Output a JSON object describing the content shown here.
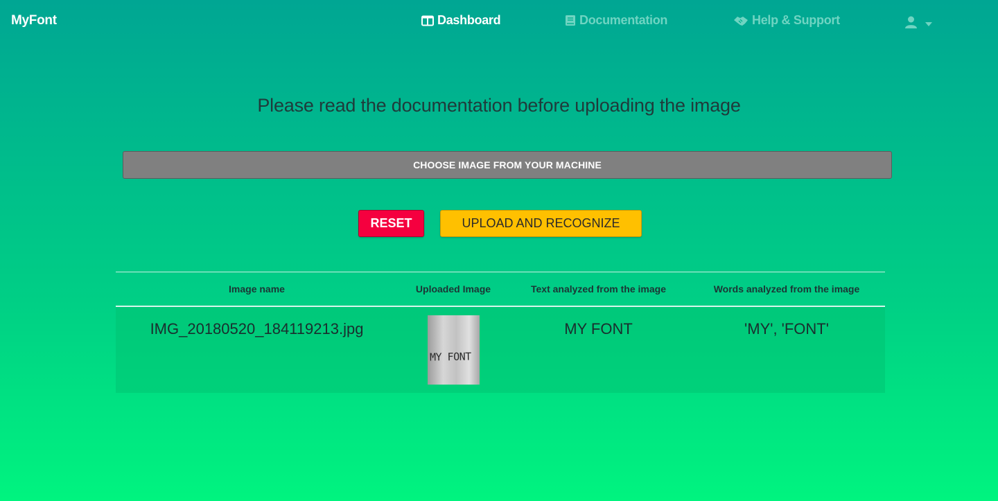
{
  "app": {
    "brand": "MyFont"
  },
  "nav": {
    "dashboard": {
      "label": "Dashboard",
      "icon": "columns-icon",
      "color": "#ffffff"
    },
    "documentation": {
      "label": "Documentation",
      "icon": "book-icon",
      "color": "#6fd4c2"
    },
    "help": {
      "label": "Help & Support",
      "icon": "handshake-icon",
      "color": "#6fd4c2"
    },
    "user": {
      "icon": "user-icon",
      "dropdown_icon": "caret-down-icon"
    }
  },
  "main": {
    "headline": "Please read the documentation before uploading the image",
    "choose_button": "CHOOSE IMAGE FROM YOUR MACHINE",
    "reset_button": "RESET",
    "upload_button": "UPLOAD AND RECOGNIZE"
  },
  "colors": {
    "reset": "#f5003f",
    "upload": "#ffc000",
    "choose": "#808080"
  },
  "table": {
    "headers": [
      "Image name",
      "Uploaded Image",
      "Text analyzed from the image",
      "Words analyzed from the image"
    ],
    "rows": [
      {
        "image_name": "IMG_20180520_184119213.jpg",
        "thumbnail_text": "MY FONT",
        "text_analyzed": "MY FONT",
        "words_analyzed": "'MY', 'FONT'"
      }
    ]
  }
}
